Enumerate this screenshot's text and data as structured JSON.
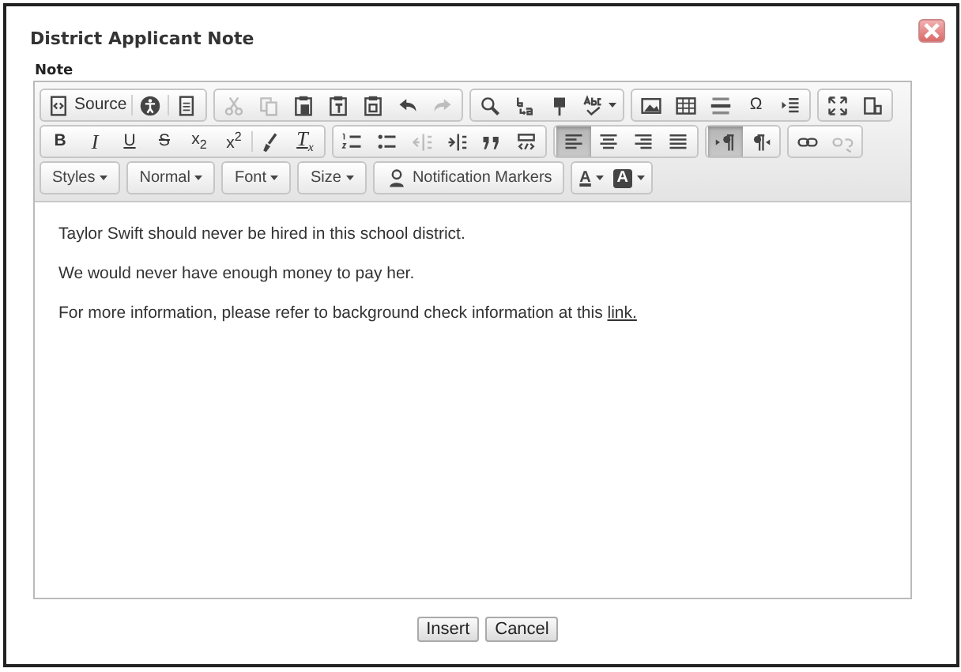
{
  "dialog": {
    "title": "District Applicant Note",
    "field_label": "Note"
  },
  "toolbar": {
    "rows": [
      {
        "groups": [
          {
            "buttons": [
              {
                "kind": "button",
                "label": "Source",
                "selected": false,
                "disabled": false
              },
              {
                "kind": "button",
                "selected": false,
                "disabled": false
              },
              {
                "kind": "button",
                "selected": false,
                "disabled": false
              }
            ]
          },
          {
            "buttons": [
              {
                "kind": "button",
                "selected": false,
                "disabled": true
              },
              {
                "kind": "button",
                "selected": false,
                "disabled": true
              },
              {
                "kind": "button",
                "selected": false,
                "disabled": false
              },
              {
                "kind": "button",
                "selected": false,
                "disabled": false
              },
              {
                "kind": "button",
                "selected": false,
                "disabled": false
              },
              {
                "kind": "button",
                "selected": false,
                "disabled": false
              },
              {
                "kind": "button",
                "selected": false,
                "disabled": true
              }
            ]
          },
          {
            "buttons": [
              {
                "kind": "button",
                "selected": false,
                "disabled": false
              },
              {
                "kind": "button",
                "selected": false,
                "disabled": false
              },
              {
                "kind": "button",
                "selected": false,
                "disabled": false
              },
              {
                "kind": "dropdown",
                "selected": false,
                "disabled": false
              }
            ]
          },
          {
            "buttons": [
              {
                "kind": "button",
                "selected": false,
                "disabled": false
              },
              {
                "kind": "button",
                "selected": false,
                "disabled": false
              },
              {
                "kind": "button",
                "selected": false,
                "disabled": false
              },
              {
                "kind": "button",
                "label": "Ω",
                "selected": false,
                "disabled": false
              },
              {
                "kind": "button",
                "selected": false,
                "disabled": false
              }
            ]
          },
          {
            "buttons": [
              {
                "kind": "button",
                "selected": false,
                "disabled": false
              },
              {
                "kind": "button",
                "selected": false,
                "disabled": false
              }
            ]
          }
        ]
      },
      {
        "groups": [
          {
            "buttons": [
              {
                "kind": "button",
                "label": "B",
                "selected": false,
                "disabled": false
              },
              {
                "kind": "button",
                "label": "I",
                "selected": false,
                "disabled": false
              },
              {
                "kind": "button",
                "label": "U",
                "selected": false,
                "disabled": false
              },
              {
                "kind": "button",
                "label": "S",
                "selected": false,
                "disabled": false
              },
              {
                "kind": "button",
                "label": "x$_{2}$",
                "selected": false,
                "disabled": false
              },
              {
                "kind": "button",
                "label": "x$^{2}$",
                "selected": false,
                "disabled": false
              },
              {
                "kind": "button",
                "selected": false,
                "disabled": false
              },
              {
                "kind": "button",
                "label": "T$_{x}$",
                "selected": false,
                "disabled": false
              }
            ]
          },
          {
            "buttons": [
              {
                "kind": "button",
                "selected": false,
                "disabled": false
              },
              {
                "kind": "button",
                "selected": false,
                "disabled": false
              },
              {
                "kind": "button",
                "selected": false,
                "disabled": true
              },
              {
                "kind": "button",
                "selected": false,
                "disabled": false
              },
              {
                "kind": "button",
                "selected": false,
                "disabled": false
              },
              {
                "kind": "button",
                "selected": false,
                "disabled": false
              }
            ]
          },
          {
            "buttons": [
              {
                "kind": "button",
                "selected": true,
                "disabled": false
              },
              {
                "kind": "button",
                "selected": false,
                "disabled": false
              },
              {
                "kind": "button",
                "selected": false,
                "disabled": false
              },
              {
                "kind": "button",
                "selected": false,
                "disabled": false
              }
            ]
          },
          {
            "buttons": [
              {
                "kind": "button",
                "selected": true,
                "disabled": false
              },
              {
                "kind": "button",
                "selected": false,
                "disabled": false
              }
            ]
          },
          {
            "buttons": [
              {
                "kind": "button",
                "selected": false,
                "disabled": false
              },
              {
                "kind": "button",
                "selected": false,
                "disabled": true
              }
            ]
          }
        ]
      },
      {
        "groups": [
          {
            "buttons": [
              {
                "kind": "dropdown",
                "label": "Styles",
                "selected": false,
                "disabled": false
              }
            ]
          },
          {
            "buttons": [
              {
                "kind": "dropdown",
                "label": "Normal",
                "selected": false,
                "disabled": false
              }
            ]
          },
          {
            "buttons": [
              {
                "kind": "dropdown",
                "label": "Font",
                "selected": false,
                "disabled": false
              }
            ]
          },
          {
            "buttons": [
              {
                "kind": "dropdown",
                "label": "Size",
                "selected": false,
                "disabled": false
              }
            ]
          },
          {
            "buttons": [
              {
                "kind": "button",
                "label": "Notification Markers",
                "selected": false,
                "disabled": false
              }
            ]
          },
          {
            "buttons": [
              {
                "kind": "dropdown",
                "label": "A",
                "selected": false,
                "disabled": false
              },
              {
                "kind": "dropdown",
                "label": "A",
                "selected": false,
                "disabled": false
              }
            ]
          }
        ]
      }
    ]
  },
  "content": {
    "paragraphs": [
      {
        "text": "Taylor Swift should never be hired in this school district."
      },
      {
        "text": "We would never have enough money to pay her."
      },
      {
        "text": "For more information, please refer to background check information at this ",
        "link": "link."
      }
    ]
  },
  "buttons": [
    {
      "label": "Insert"
    },
    {
      "label": "Cancel"
    }
  ]
}
